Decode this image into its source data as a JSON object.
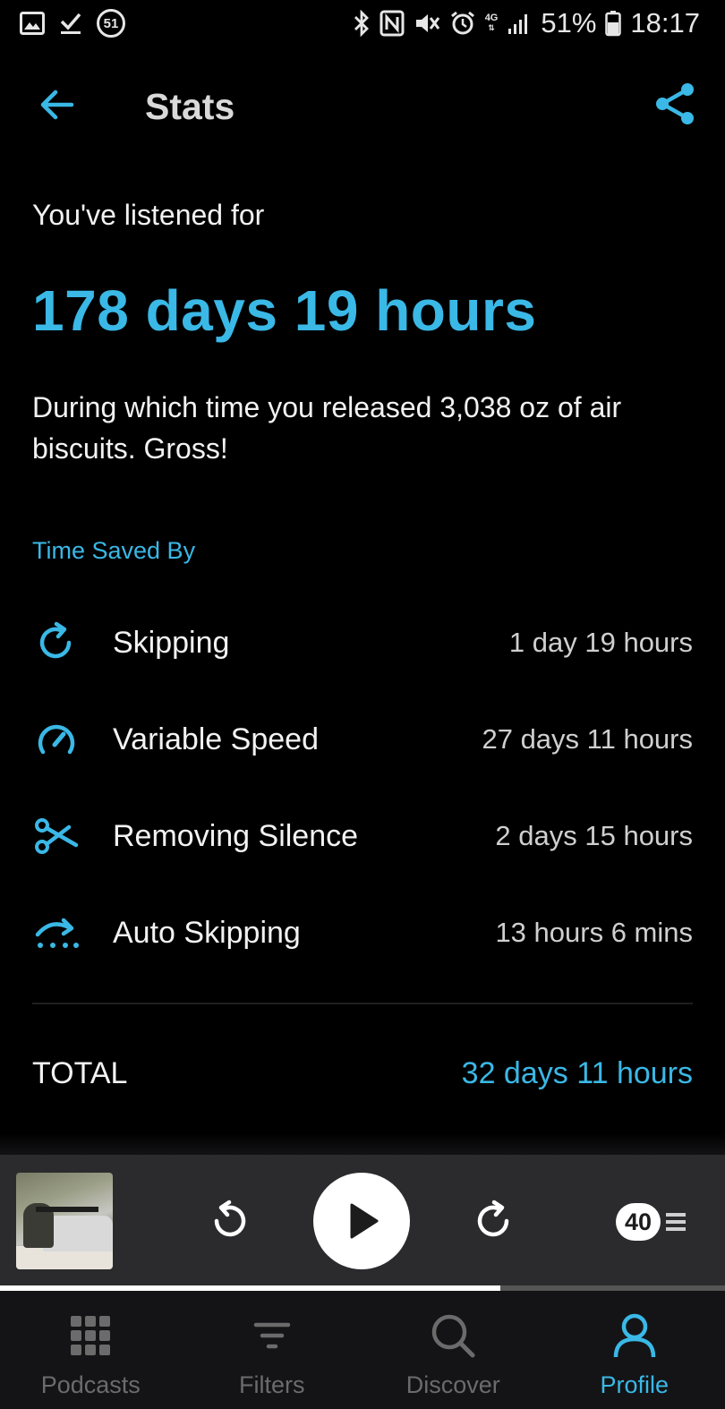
{
  "status_bar": {
    "notification_badge": "51",
    "battery": "51%",
    "time": "18:17",
    "network_label": "4G"
  },
  "header": {
    "title": "Stats"
  },
  "summary": {
    "intro": "You've listened for",
    "total_listened": "178 days 19 hours",
    "fun_fact": "During which time you released 3,038 oz of air biscuits. Gross!"
  },
  "time_saved": {
    "section_title": "Time Saved By",
    "items": [
      {
        "label": "Skipping",
        "value": "1 day 19 hours",
        "icon": "skip-forward-icon"
      },
      {
        "label": "Variable Speed",
        "value": "27 days 11 hours",
        "icon": "speedometer-icon"
      },
      {
        "label": "Removing Silence",
        "value": "2 days 15 hours",
        "icon": "scissors-icon"
      },
      {
        "label": "Auto Skipping",
        "value": "13 hours 6 mins",
        "icon": "auto-skip-icon"
      }
    ],
    "total_label": "TOTAL",
    "total_value": "32 days 11 hours"
  },
  "player": {
    "queue_count": "40",
    "progress": 0.69
  },
  "bottom_nav": {
    "items": [
      {
        "label": "Podcasts",
        "active": false
      },
      {
        "label": "Filters",
        "active": false
      },
      {
        "label": "Discover",
        "active": false
      },
      {
        "label": "Profile",
        "active": true
      }
    ]
  },
  "colors": {
    "accent": "#3ab8e6",
    "background": "#000000",
    "player_background": "#2b2b2d",
    "nav_background": "#141416"
  }
}
